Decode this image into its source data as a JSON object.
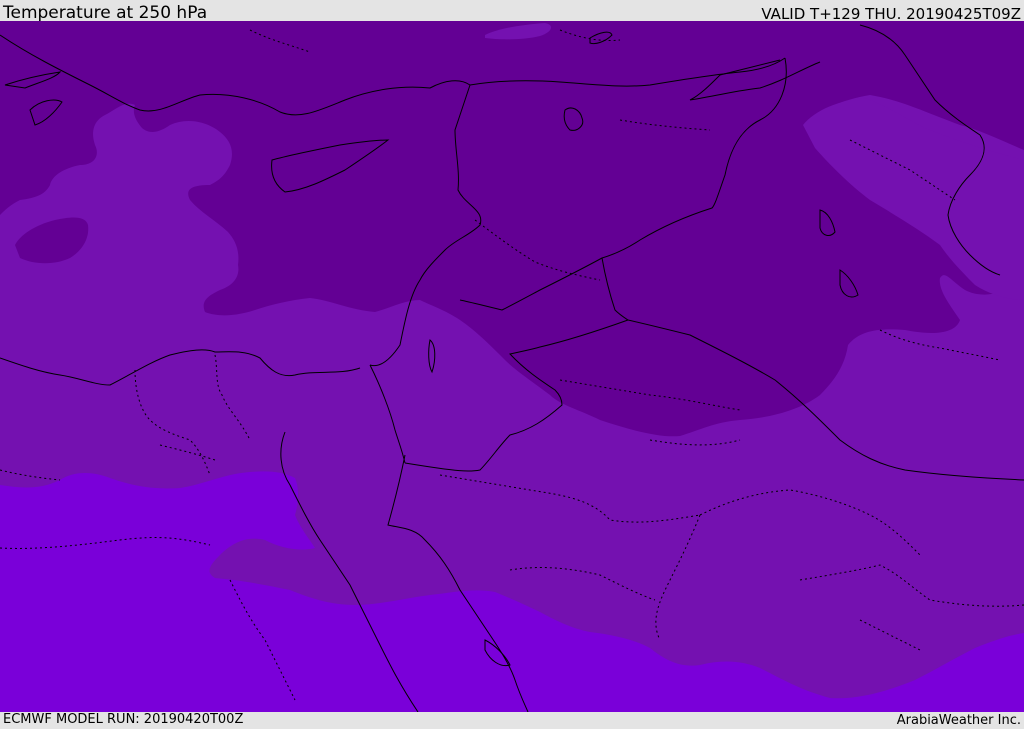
{
  "header": {
    "title": "Temperature at 250 hPa",
    "valid": "VALID T+129 THU. 20190425T09Z"
  },
  "footer": {
    "model_run": "ECMWF MODEL RUN: 20190420T00Z",
    "credit": "ArabiaWeather Inc."
  },
  "map": {
    "field": "temperature",
    "level": "250 hPa",
    "colors": {
      "coldest": "#630094",
      "cold": "#7411b0",
      "mid": "#7a00d9",
      "coastline": "#000000",
      "borders": "#000000"
    }
  }
}
